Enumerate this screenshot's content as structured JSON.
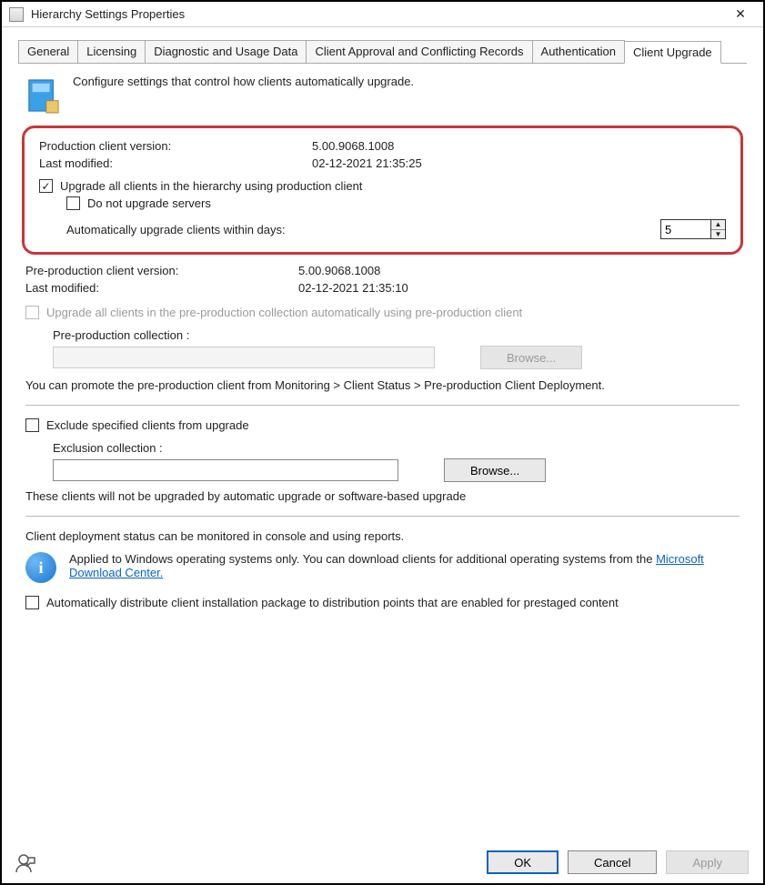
{
  "window": {
    "title": "Hierarchy Settings Properties"
  },
  "tabs": [
    {
      "label": "General"
    },
    {
      "label": "Licensing"
    },
    {
      "label": "Diagnostic and Usage Data"
    },
    {
      "label": "Client Approval and Conflicting Records"
    },
    {
      "label": "Authentication"
    },
    {
      "label": "Client Upgrade"
    }
  ],
  "intro": "Configure settings that control how clients automatically upgrade.",
  "prod": {
    "version_label": "Production client version:",
    "version_value": "5.00.9068.1008",
    "modified_label": "Last modified:",
    "modified_value": "02-12-2021 21:35:25",
    "upgrade_all_label": "Upgrade all clients in the hierarchy using production client",
    "no_servers_label": "Do not upgrade servers",
    "days_label": "Automatically upgrade clients within days:",
    "days_value": "5"
  },
  "preprod": {
    "version_label": "Pre-production client version:",
    "version_value": "5.00.9068.1008",
    "modified_label": "Last modified:",
    "modified_value": "02-12-2021 21:35:10",
    "upgrade_label": "Upgrade all clients in the pre-production collection automatically using pre-production client",
    "collection_label": "Pre-production collection :",
    "browse_label": "Browse...",
    "promote_text": "You can promote the pre-production client from Monitoring > Client Status > Pre-production Client Deployment."
  },
  "exclude": {
    "checkbox_label": "Exclude specified clients from upgrade",
    "collection_label": "Exclusion collection :",
    "browse_label": "Browse...",
    "note": "These clients will not be upgraded by automatic upgrade or software-based upgrade"
  },
  "deploy": {
    "status_text": "Client deployment status can be monitored in console and using reports.",
    "info_text": "Applied to Windows operating systems only. You can download clients for additional operating systems from the ",
    "link_text": "Microsoft Download Center.",
    "auto_dist_label": "Automatically distribute client installation package to distribution points that are enabled for prestaged content"
  },
  "buttons": {
    "ok": "OK",
    "cancel": "Cancel",
    "apply": "Apply"
  }
}
